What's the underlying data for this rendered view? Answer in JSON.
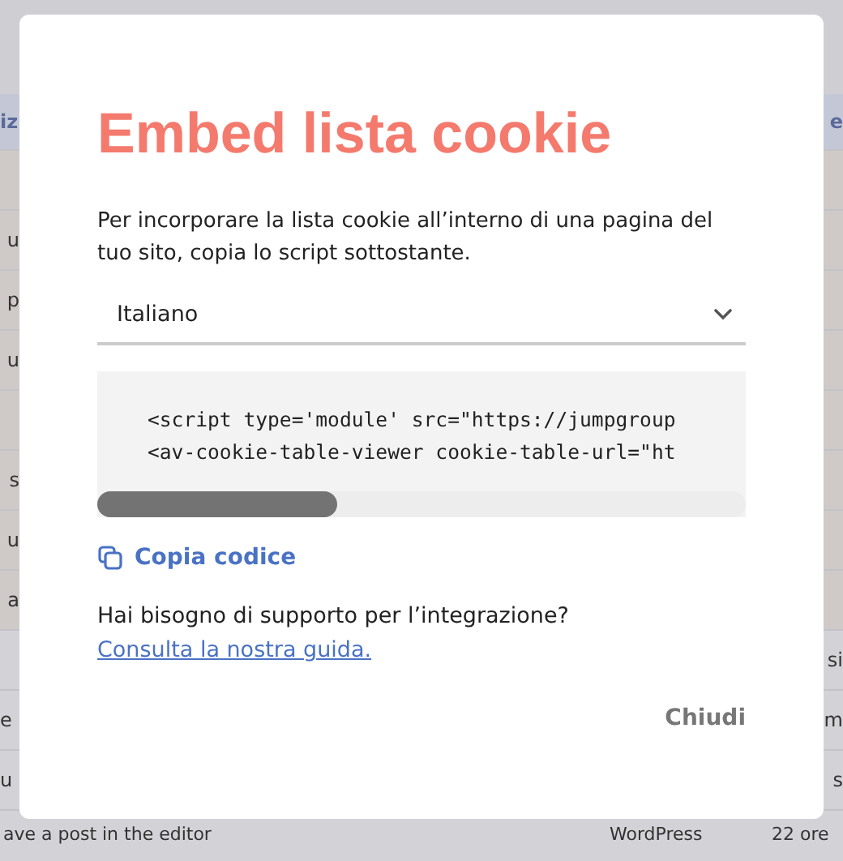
{
  "background_table": {
    "header": {
      "left": "iz",
      "right": "e"
    },
    "rows": [
      {
        "highlighted": true
      },
      {
        "left": "u",
        "highlighted": true
      },
      {
        "left": "p",
        "highlighted": true
      },
      {
        "left": "u",
        "highlighted": true
      },
      {
        "highlighted": true
      },
      {
        "left": "s",
        "highlighted": true
      },
      {
        "left": "u",
        "highlighted": true
      },
      {
        "left": "a",
        "highlighted": true
      },
      {
        "right": "si",
        "highlighted": false
      },
      {
        "left": "e",
        "right": "m",
        "highlighted": false
      },
      {
        "left": "u",
        "right": "s",
        "highlighted": false
      }
    ],
    "last_row": [
      "ave a post in the editor",
      "WordPress",
      "22 ore"
    ]
  },
  "dialog": {
    "title": "Embed lista cookie",
    "description": "Per incorporare la lista cookie all’interno di una pagina del tuo sito, copia lo script sottostante.",
    "language_select": {
      "value": "Italiano"
    },
    "code_lines": [
      "<script type='module' src=\"https://jumpgroup",
      "<av-cookie-table-viewer cookie-table-url=\"ht"
    ],
    "copy_button": "Copia codice",
    "help_text": "Hai bisogno di supporto per l’integrazione?",
    "help_link": "Consulta la nostra guida.",
    "close_button": "Chiudi"
  }
}
